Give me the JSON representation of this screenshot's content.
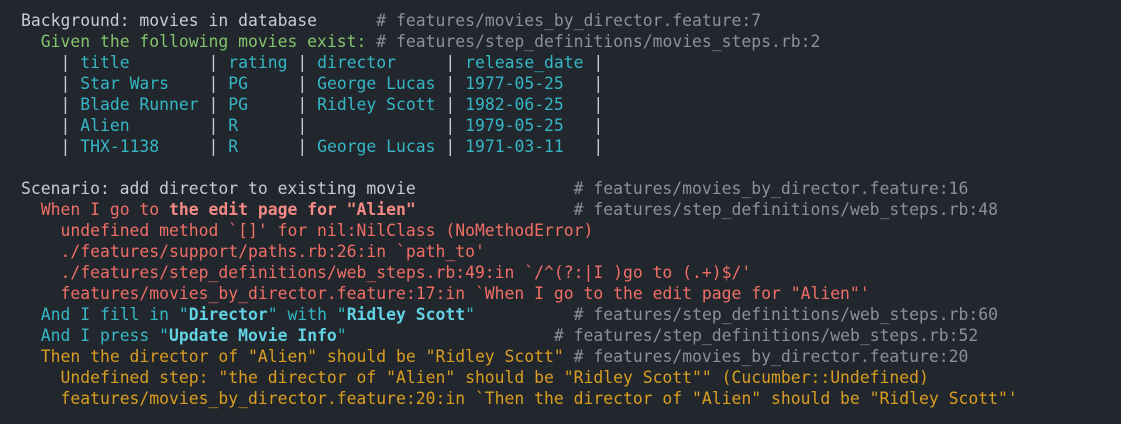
{
  "background": {
    "title": "Background: movies in database",
    "title_pad": "      ",
    "source": "# features/movies_by_director.feature:7",
    "step": {
      "text": "Given the following movies exist:",
      "source": "# features/step_definitions/movies_steps.rb:2"
    },
    "table": {
      "header": [
        " title        ",
        " rating ",
        " director     ",
        " release_date "
      ],
      "rows": [
        [
          " Star Wars    ",
          " PG     ",
          " George Lucas ",
          " 1977-05-25   "
        ],
        [
          " Blade Runner ",
          " PG     ",
          " Ridley Scott ",
          " 1982-06-25   "
        ],
        [
          " Alien        ",
          " R      ",
          "              ",
          " 1979-05-25   "
        ],
        [
          " THX-1138     ",
          " R      ",
          " George Lucas ",
          " 1971-03-11   "
        ]
      ]
    }
  },
  "scenario": {
    "title": "Scenario: add director to existing movie",
    "title_pad": "                ",
    "source": "# features/movies_by_director.feature:16",
    "steps": {
      "s1": {
        "pre": "When I go to ",
        "arg": "the edit page for \"Alien\"",
        "pad": "                ",
        "source": "# features/step_definitions/web_steps.rb:48",
        "error": [
          "undefined method `[]' for nil:NilClass (NoMethodError)",
          "./features/support/paths.rb:26:in `path_to'",
          "./features/step_definitions/web_steps.rb:49:in `/^(?:|I )go to (.+)$/'",
          "features/movies_by_director.feature:17:in `When I go to the edit page for \"Alien\"'"
        ]
      },
      "s2": {
        "p1": "And I fill in \"",
        "a1": "Director",
        "p2": "\" with \"",
        "a2": "Ridley Scott",
        "p3": "\"",
        "pad": "          ",
        "source": "# features/step_definitions/web_steps.rb:60"
      },
      "s3": {
        "p1": "And I press \"",
        "a1": "Update Movie Info",
        "p2": "\"",
        "pad": "                     ",
        "source": "# features/step_definitions/web_steps.rb:52"
      },
      "s4": {
        "text": "Then the director of \"Alien\" should be \"Ridley Scott\"",
        "pad": " ",
        "source": "# features/movies_by_director.feature:20",
        "undefined": [
          "Undefined step: \"the director of \"Alien\" should be \"Ridley Scott\"\" (Cucumber::Undefined)",
          "features/movies_by_director.feature:20:in `Then the director of \"Alien\" should be \"Ridley Scott\"'"
        ]
      }
    }
  },
  "colors": {
    "background": "#22262d",
    "passed": "#82c46c",
    "skipped": "#35b7c6",
    "failed": "#ef6f66",
    "undefined": "#d99e20",
    "comment": "#8b9099"
  }
}
